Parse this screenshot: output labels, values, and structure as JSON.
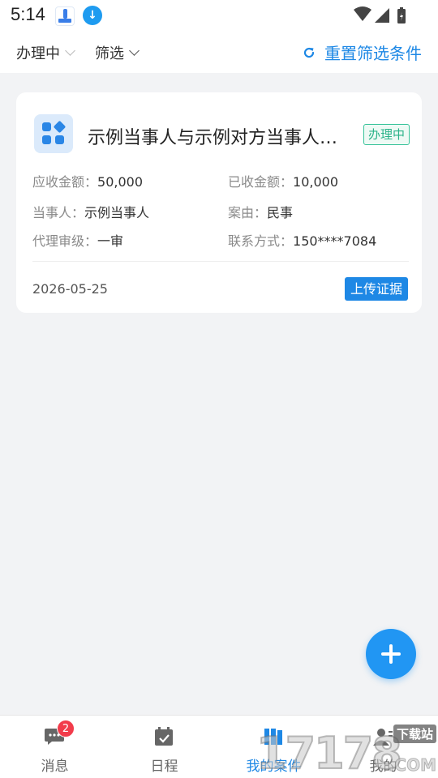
{
  "status_bar": {
    "time": "5:14"
  },
  "filters": {
    "status_label": "办理中",
    "screen_label": "筛选",
    "reset_label": "重置筛选条件"
  },
  "case": {
    "title": "示例当事人与示例对方当事人之间的案件",
    "status": "办理中",
    "receivable_label": "应收金额：",
    "receivable_value": "50,000",
    "received_label": "已收金额：",
    "received_value": "10,000",
    "party_label": "当事人：",
    "party_value": "示例当事人",
    "cause_label": "案由：",
    "cause_value": "民事",
    "level_label": "代理审级：",
    "level_value": "一审",
    "contact_label": "联系方式：",
    "contact_value": "150****7084",
    "date": "2026-05-25",
    "upload_label": "上传证据"
  },
  "tabs": [
    {
      "label": "消息",
      "badge": "2",
      "icon": "message-icon"
    },
    {
      "label": "日程",
      "icon": "calendar-icon"
    },
    {
      "label": "我的案件",
      "icon": "case-folder-icon",
      "active": true
    },
    {
      "label": "我的",
      "icon": "profile-icon"
    }
  ],
  "watermark": {
    "digits": "17178",
    "site": "下载站",
    "com": ".COM"
  },
  "colors": {
    "accent": "#1e88e5",
    "status_green": "#2ab389",
    "badge_red": "#f23c4b",
    "background": "#f2f3f5"
  }
}
